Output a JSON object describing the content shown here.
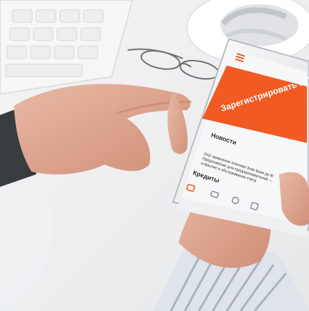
{
  "phone_screen": {
    "cta_banner": {
      "label": "Зарегистрировать ИП"
    },
    "news_section": {
      "title": "Новости",
      "item_text_lines": [
        "ZAZ-заявление платежи Знак Банк до 8!",
        "Предложение для предпринимателей —",
        "открытие и обслуживание счета"
      ]
    },
    "credits_section": {
      "title": "Кредиты"
    }
  },
  "colors": {
    "accent": "#f15a22",
    "screen_bg": "#f6f7f8",
    "text_dark": "#2b2b2b"
  }
}
